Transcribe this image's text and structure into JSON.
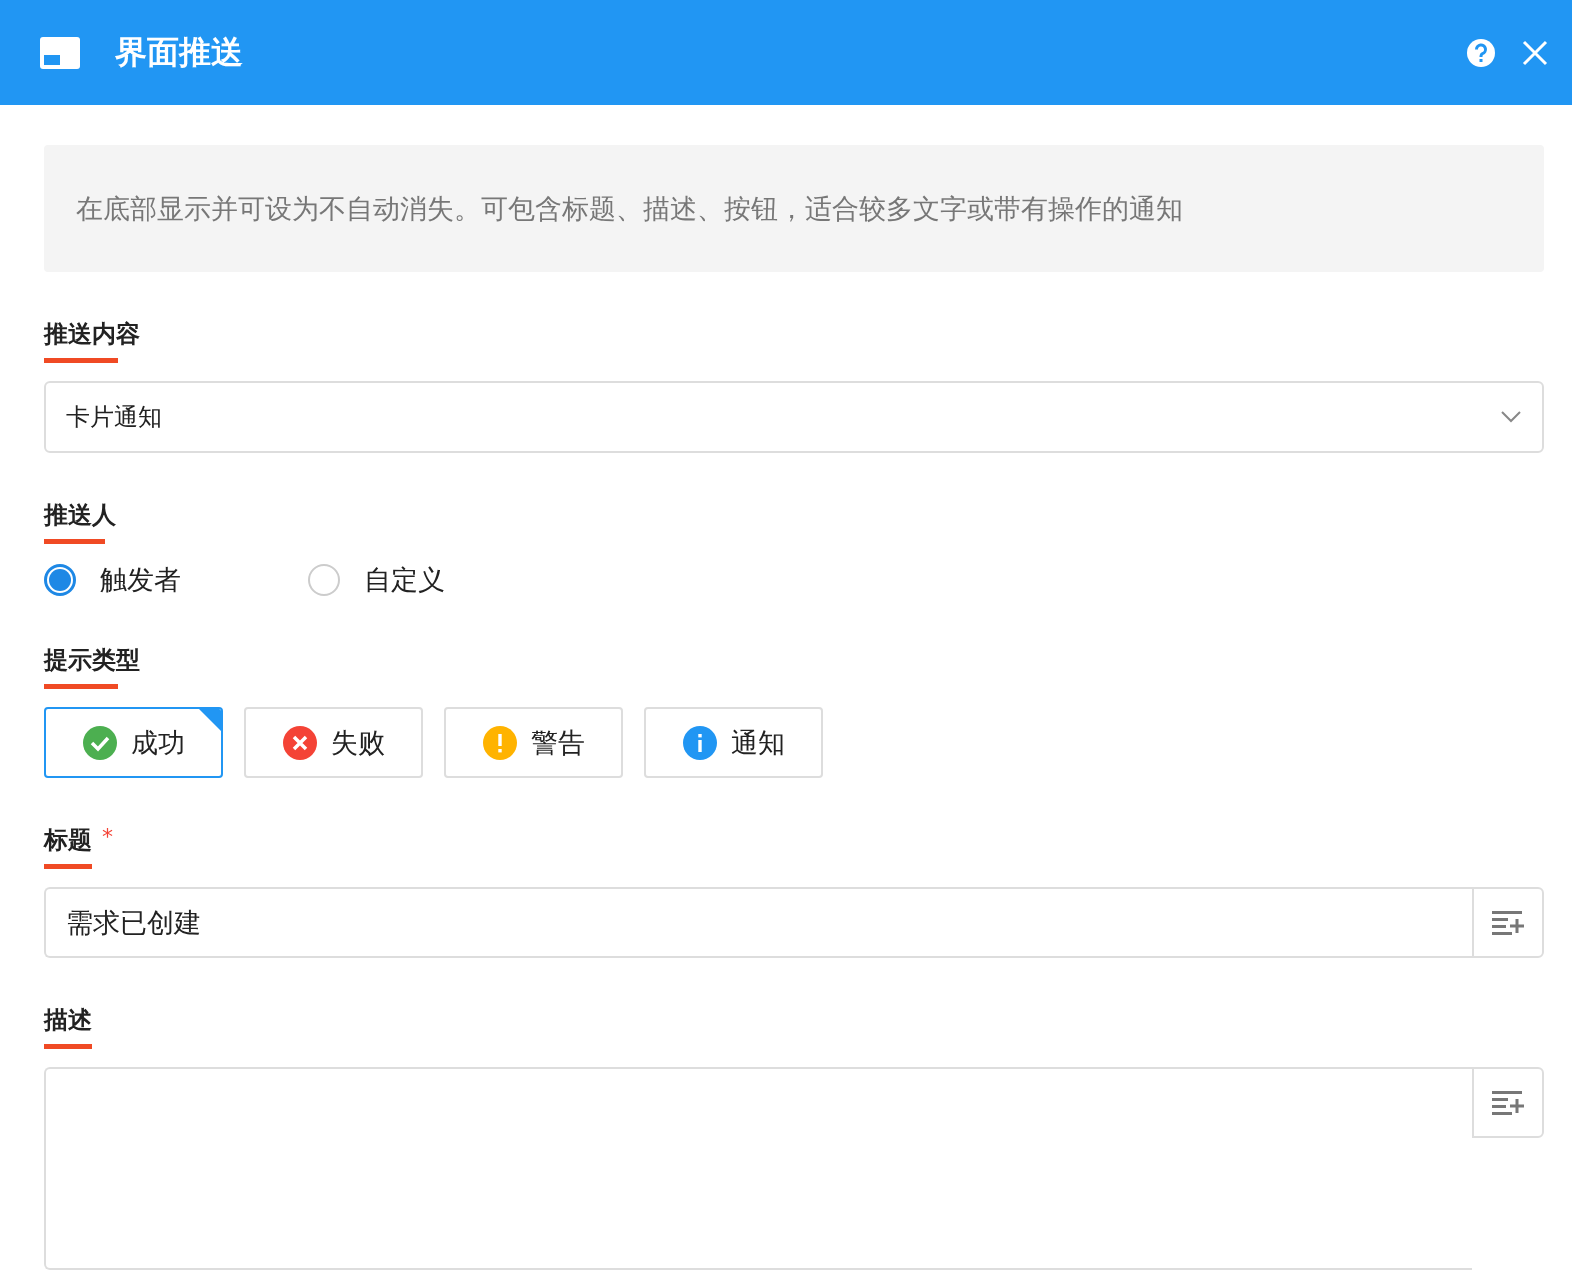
{
  "window": {
    "title": "界面推送"
  },
  "description": "在底部显示并可设为不自动消失。可包含标题、描述、按钮，适合较多文字或带有操作的通知",
  "push_content": {
    "label": "推送内容",
    "value": "卡片通知"
  },
  "pusher": {
    "label": "推送人",
    "options": [
      {
        "label": "触发者",
        "selected": true
      },
      {
        "label": "自定义",
        "selected": false
      }
    ]
  },
  "prompt_type": {
    "label": "提示类型",
    "options": [
      {
        "label": "成功",
        "kind": "success",
        "selected": true
      },
      {
        "label": "失败",
        "kind": "error",
        "selected": false
      },
      {
        "label": "警告",
        "kind": "warning",
        "selected": false
      },
      {
        "label": "通知",
        "kind": "info",
        "selected": false
      }
    ]
  },
  "title_field": {
    "label": "标题",
    "required_mark": "*",
    "value": "需求已创建"
  },
  "description_field": {
    "label": "描述"
  }
}
